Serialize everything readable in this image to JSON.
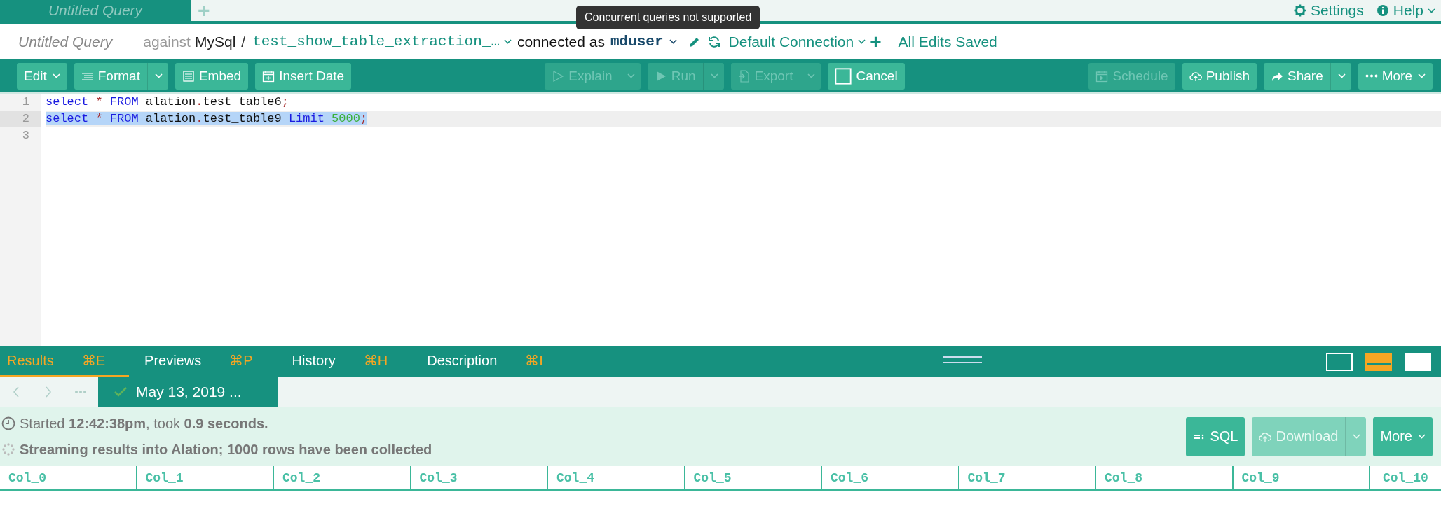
{
  "tabs": [
    {
      "label": "Untitled Query",
      "selected": true
    }
  ],
  "add_tab": "+",
  "header_links": [
    {
      "kind": "settings",
      "label": "Settings"
    },
    {
      "kind": "help",
      "label": "Help"
    }
  ],
  "query_bar": {
    "title": "Untitled Query",
    "against": "against",
    "database": "MySql",
    "separator": "/",
    "schema": "test_show_table_extraction_…",
    "connected_as": "connected as",
    "user": "mduser",
    "connection": "Default Connection",
    "add": "+",
    "save_status": "All Edits Saved"
  },
  "tooltip": "Concurrent queries not supported",
  "toolbar": {
    "left": [
      {
        "label": "Edit",
        "disabled": false
      },
      {
        "label": "Format",
        "disabled": false
      },
      {
        "label": "Embed",
        "disabled": false
      },
      {
        "label": "Insert Date",
        "disabled": false
      }
    ],
    "center": [
      {
        "label": "Explain",
        "disabled": true
      },
      {
        "label": "Run",
        "disabled": true
      },
      {
        "label": "Export",
        "disabled": true
      },
      {
        "label": "Cancel",
        "disabled": false
      }
    ],
    "right": [
      {
        "label": "Schedule",
        "disabled": true
      },
      {
        "label": "Publish",
        "disabled": false
      },
      {
        "label": "Share",
        "disabled": false
      },
      {
        "label": "More",
        "disabled": false
      }
    ]
  },
  "editor": {
    "lines": [
      {
        "number": "1",
        "selected": false,
        "tokens": [
          {
            "kind": "keyword",
            "text": "select"
          },
          {
            "kind": "operator",
            "text": " * "
          },
          {
            "kind": "keyword",
            "text": "FROM"
          },
          {
            "kind": "plain",
            "text": " alation"
          },
          {
            "kind": "operator",
            "text": "."
          },
          {
            "kind": "plain",
            "text": "test_table6"
          },
          {
            "kind": "operator",
            "text": ";"
          }
        ]
      },
      {
        "number": "2",
        "selected": true,
        "tokens": [
          {
            "kind": "keyword",
            "text": "select"
          },
          {
            "kind": "operator",
            "text": " * "
          },
          {
            "kind": "keyword",
            "text": "FROM"
          },
          {
            "kind": "plain",
            "text": " alation"
          },
          {
            "kind": "operator",
            "text": "."
          },
          {
            "kind": "plain",
            "text": "test_table9 "
          },
          {
            "kind": "keyword",
            "text": "Limit"
          },
          {
            "kind": "number",
            "text": " 5000"
          },
          {
            "kind": "operator",
            "text": ";"
          }
        ]
      },
      {
        "number": "3",
        "selected": false
      }
    ]
  },
  "result_tabs": [
    {
      "label": "Results",
      "shortcut": "⌘E",
      "selected": true
    },
    {
      "label": "Previews",
      "shortcut": "⌘P",
      "selected": false
    },
    {
      "label": "History",
      "shortcut": "⌘H",
      "selected": false
    },
    {
      "label": "Description",
      "shortcut": "⌘I",
      "selected": false
    }
  ],
  "layout_toggles": [
    {
      "kind": "editor",
      "selected": false
    },
    {
      "kind": "split",
      "selected": true
    },
    {
      "kind": "results",
      "selected": false
    }
  ],
  "run_tabs": [
    {
      "label": "May 13, 2019 ...",
      "selected": true
    }
  ],
  "info": {
    "started": "Started **12:42:38pm**, took **0.9 seconds.**",
    "streaming": "Streaming results into Alation; 1000 rows have been collected"
  },
  "result_buttons": [
    {
      "label": "SQL",
      "disabled": false
    },
    {
      "label": "Download",
      "disabled": true
    },
    {
      "label": "More",
      "disabled": false
    }
  ],
  "columns": [
    "Col_0",
    "Col_1",
    "Col_2",
    "Col_3",
    "Col_4",
    "Col_5",
    "Col_6",
    "Col_7",
    "Col_8",
    "Col_9",
    "Col_10"
  ]
}
